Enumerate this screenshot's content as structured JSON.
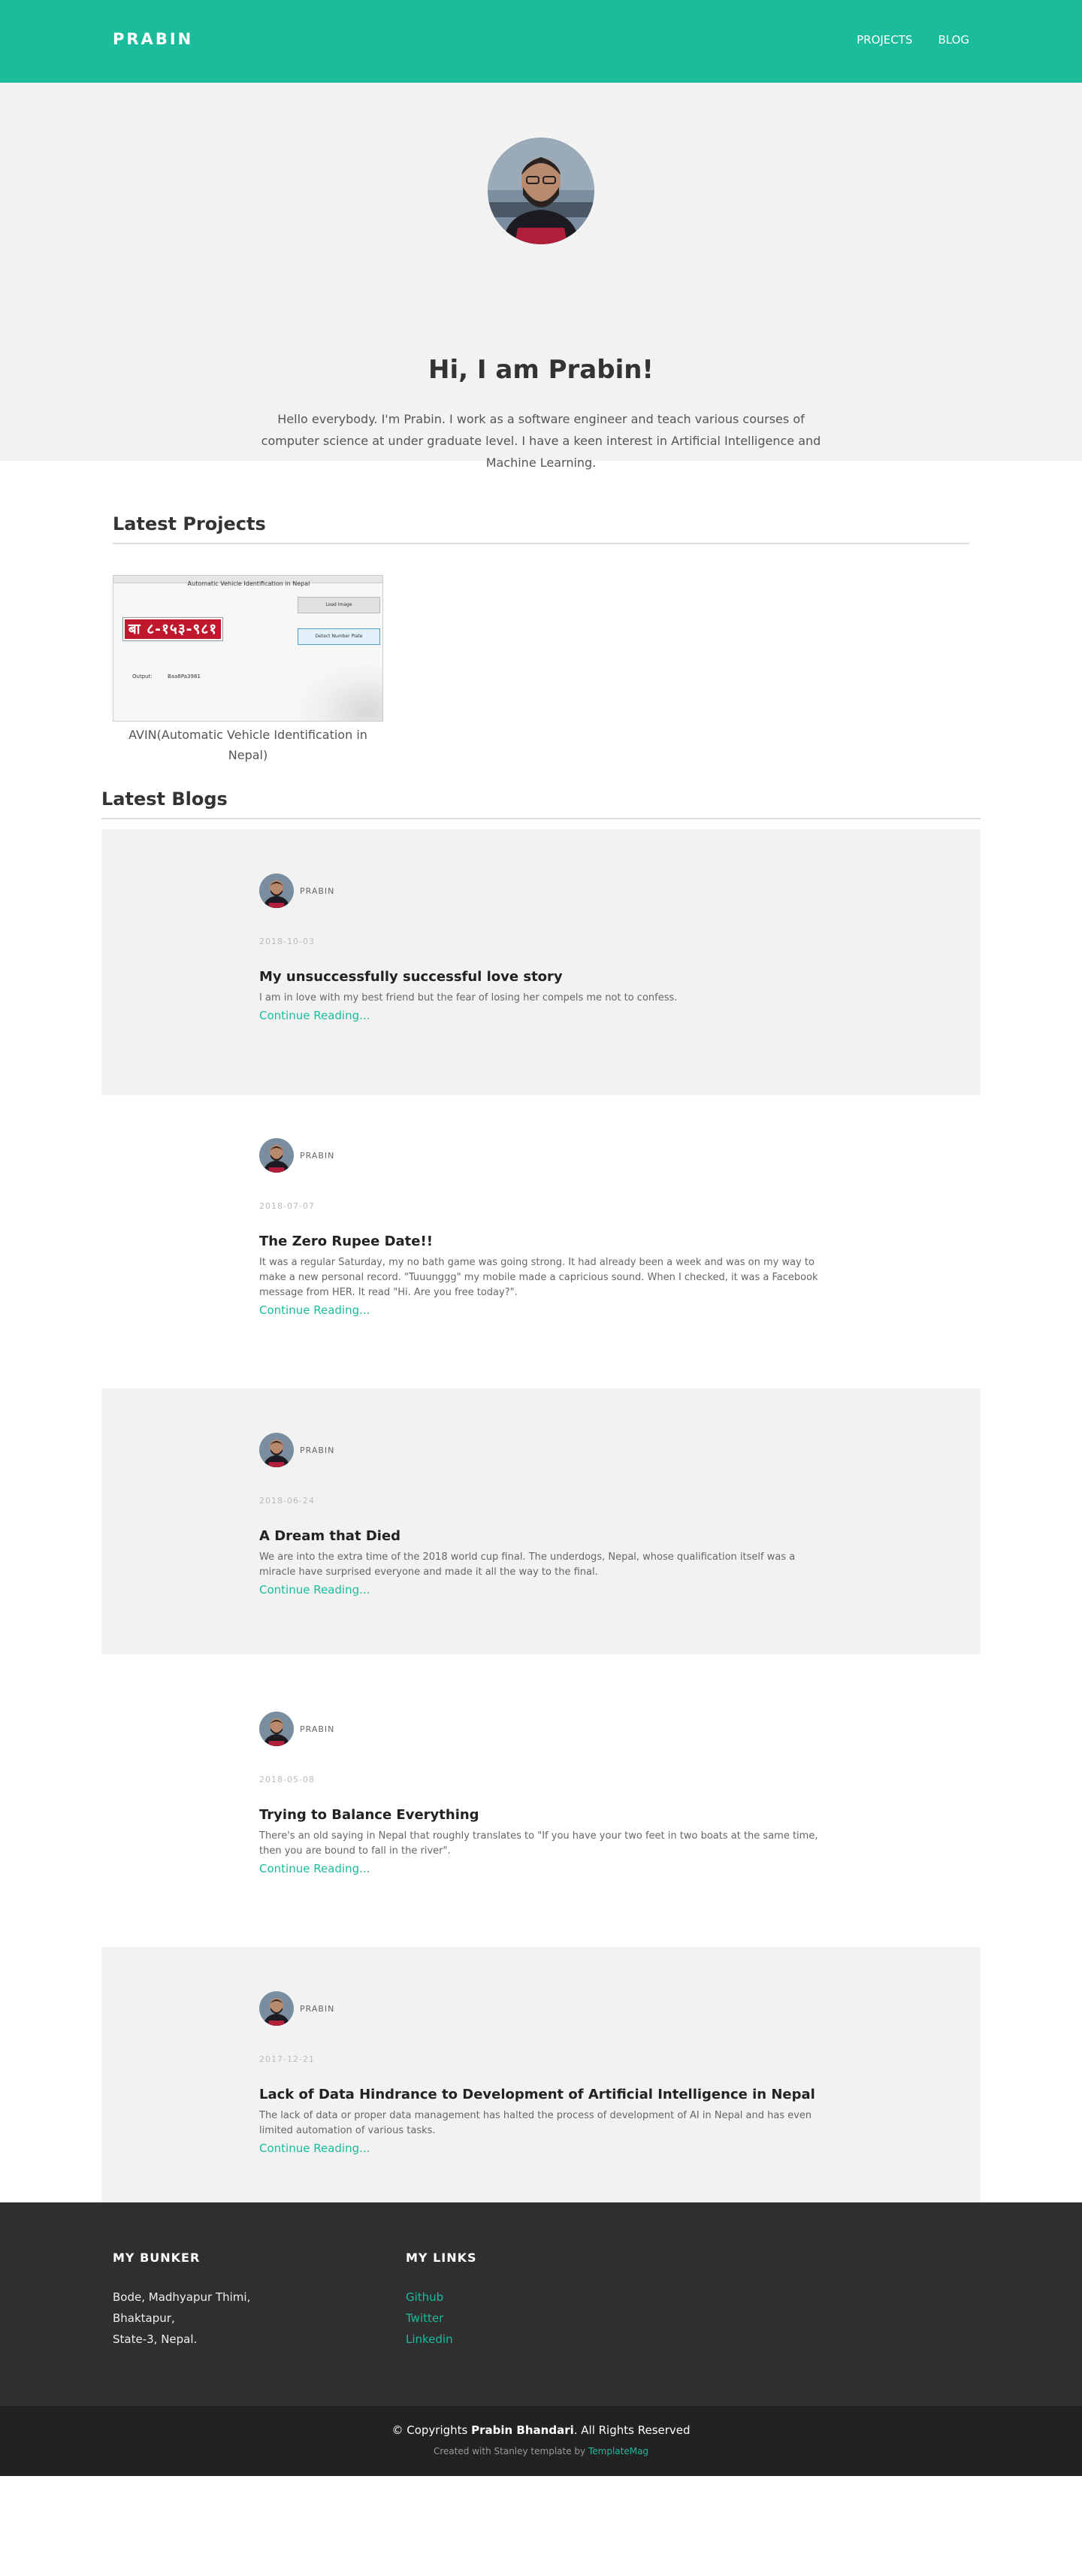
{
  "nav": {
    "brand": "PRABIN",
    "links": [
      "PROJECTS",
      "BLOG"
    ]
  },
  "hero": {
    "title": "Hi, I am Prabin!",
    "intro": "Hello everybody. I'm Prabin. I work as a software engineer and teach various courses of computer science at under graduate level. I have a keen interest in Artificial Intelligence and Machine Learning."
  },
  "projects": {
    "heading": "Latest Projects",
    "items": [
      {
        "caption": "AVIN(Automatic Vehicle Identification in Nepal)",
        "thumb": {
          "window_title": "Automatic Vehicle Identification in Nepal",
          "plate": "बा ८-१५३-९८१",
          "btn_load": "Load Image",
          "btn_detect": "Detect Number Plate",
          "output_label": "Output:",
          "output_value": "Baa8Pa3981"
        }
      }
    ]
  },
  "blogs": {
    "heading": "Latest Blogs",
    "more_label": "Continue Reading...",
    "posts": [
      {
        "author": "PRABIN",
        "date": "2018-10-03",
        "title": "My unsuccessfully successful love story",
        "excerpt": "I am in love with my best friend but the fear of losing her compels me not to confess."
      },
      {
        "author": "PRABIN",
        "date": "2018-07-07",
        "title": "The Zero Rupee Date!!",
        "excerpt": "It was a regular Saturday, my no bath game was going strong. It had already been a week and was on my way to make a new personal record. \"Tuuunggg\" my mobile made a capricious sound. When I checked, it was a Facebook message from HER. It read \"Hi. Are you free today?\"."
      },
      {
        "author": "PRABIN",
        "date": "2018-06-24",
        "title": "A Dream that Died",
        "excerpt": "We are into the extra time of the 2018 world cup final. The underdogs, Nepal, whose qualification itself was a miracle have surprised everyone and made it all the way to the final."
      },
      {
        "author": "PRABIN",
        "date": "2018-05-08",
        "title": "Trying to Balance Everything",
        "excerpt": "There's an old saying in Nepal that roughly translates to \"If you have your two feet in two boats at the same time, then you are bound to fall in the river\"."
      },
      {
        "author": "PRABIN",
        "date": "2017-12-21",
        "title": "Lack of Data Hindrance to Development of Artificial Intelligence in Nepal",
        "excerpt": "The lack of data or proper data management has halted the process of development of AI in Nepal and has even limited automation of various tasks."
      }
    ]
  },
  "footer": {
    "bunker_heading": "MY BUNKER",
    "address": [
      "Bode, Madhyapur Thimi,",
      "Bhaktapur,",
      "State-3, Nepal."
    ],
    "links_heading": "MY LINKS",
    "links": [
      "Github",
      "Twitter",
      "Linkedin"
    ]
  },
  "copyright": {
    "prefix": "© Copyrights",
    "name": "Prabin Bhandari",
    "suffix": ". All Rights Reserved",
    "credit_prefix": "Created with Stanley template by",
    "credit_link": "TemplateMag"
  },
  "colors": {
    "accent": "#1abc9c",
    "hero_bg": "#f2f2f2",
    "footer_bg": "#2f2f2f",
    "copy_bg": "#222222"
  }
}
